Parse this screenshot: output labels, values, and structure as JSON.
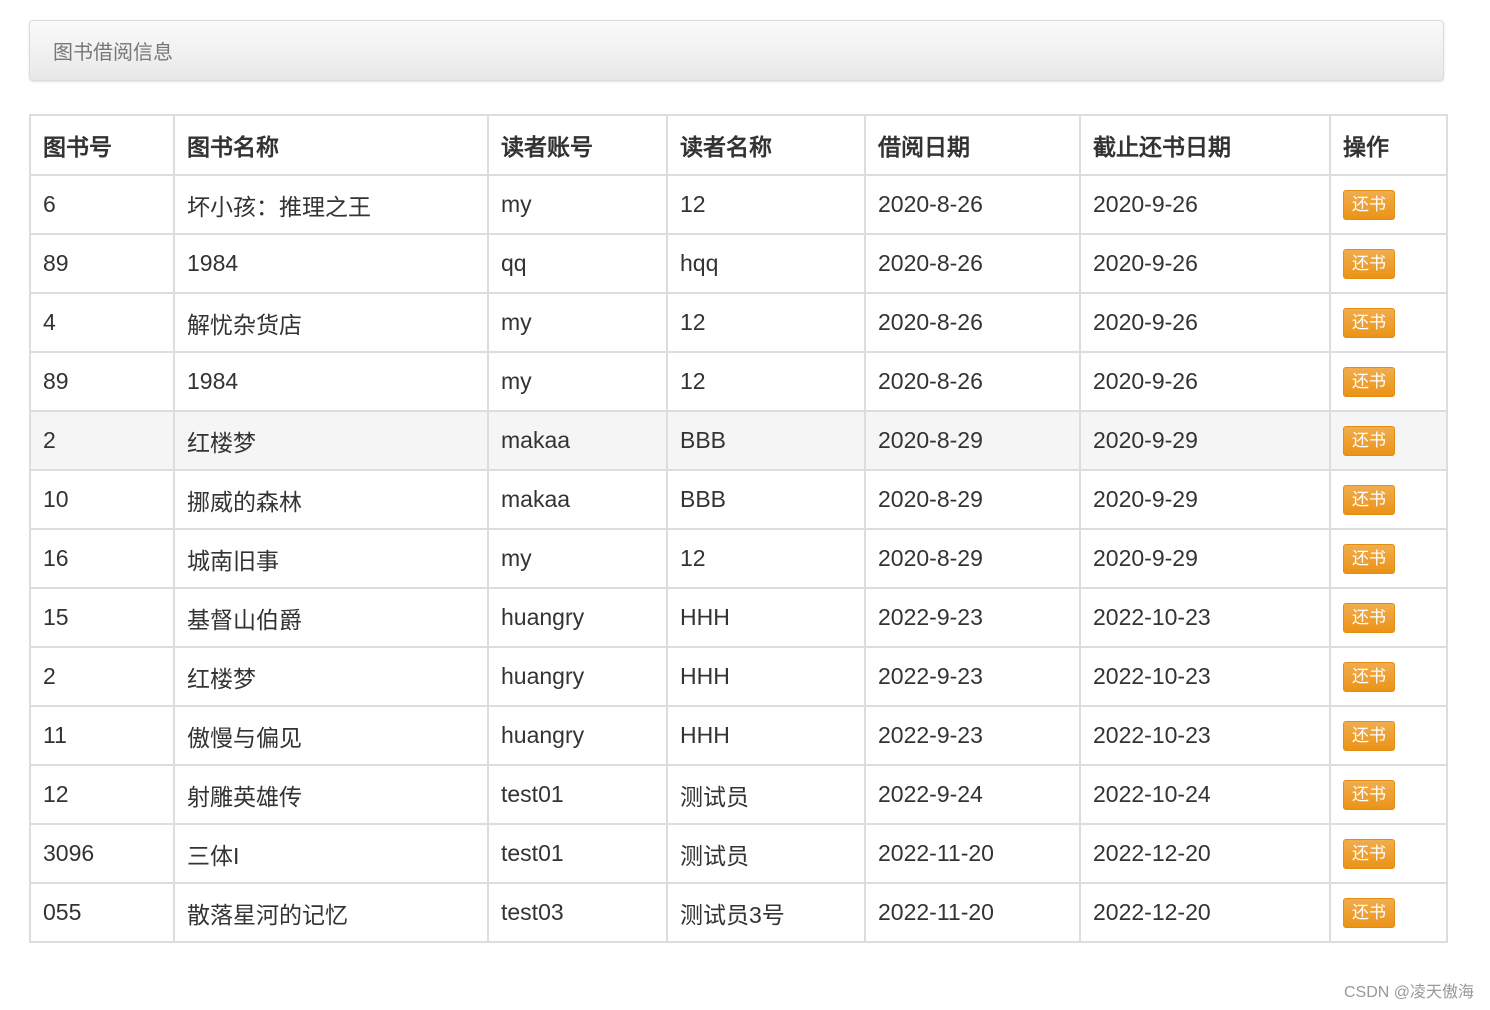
{
  "panel": {
    "title": "图书借阅信息"
  },
  "table": {
    "columns": [
      "图书号",
      "图书名称",
      "读者账号",
      "读者名称",
      "借阅日期",
      "截止还书日期",
      "操作"
    ],
    "action_label": "还书",
    "rows": [
      {
        "book_id": "6",
        "book_name": "坏小孩：推理之王",
        "reader_account": "my",
        "reader_name": "12",
        "borrow_date": "2020-8-26",
        "due_date": "2020-9-26"
      },
      {
        "book_id": "89",
        "book_name": "1984",
        "reader_account": "qq",
        "reader_name": "hqq",
        "borrow_date": "2020-8-26",
        "due_date": "2020-9-26"
      },
      {
        "book_id": "4",
        "book_name": "解忧杂货店",
        "reader_account": "my",
        "reader_name": "12",
        "borrow_date": "2020-8-26",
        "due_date": "2020-9-26"
      },
      {
        "book_id": "89",
        "book_name": "1984",
        "reader_account": "my",
        "reader_name": "12",
        "borrow_date": "2020-8-26",
        "due_date": "2020-9-26"
      },
      {
        "book_id": "2",
        "book_name": "红楼梦",
        "reader_account": "makaa",
        "reader_name": "BBB",
        "borrow_date": "2020-8-29",
        "due_date": "2020-9-29"
      },
      {
        "book_id": "10",
        "book_name": "挪威的森林",
        "reader_account": "makaa",
        "reader_name": "BBB",
        "borrow_date": "2020-8-29",
        "due_date": "2020-9-29"
      },
      {
        "book_id": "16",
        "book_name": "城南旧事",
        "reader_account": "my",
        "reader_name": "12",
        "borrow_date": "2020-8-29",
        "due_date": "2020-9-29"
      },
      {
        "book_id": "15",
        "book_name": "基督山伯爵",
        "reader_account": "huangry",
        "reader_name": "HHH",
        "borrow_date": "2022-9-23",
        "due_date": "2022-10-23"
      },
      {
        "book_id": "2",
        "book_name": "红楼梦",
        "reader_account": "huangry",
        "reader_name": "HHH",
        "borrow_date": "2022-9-23",
        "due_date": "2022-10-23"
      },
      {
        "book_id": "11",
        "book_name": "傲慢与偏见",
        "reader_account": "huangry",
        "reader_name": "HHH",
        "borrow_date": "2022-9-23",
        "due_date": "2022-10-23"
      },
      {
        "book_id": "12",
        "book_name": "射雕英雄传",
        "reader_account": "test01",
        "reader_name": "测试员",
        "borrow_date": "2022-9-24",
        "due_date": "2022-10-24"
      },
      {
        "book_id": "3096",
        "book_name": "三体I",
        "reader_account": "test01",
        "reader_name": "测试员",
        "borrow_date": "2022-11-20",
        "due_date": "2022-12-20"
      },
      {
        "book_id": "055",
        "book_name": "散落星河的记忆",
        "reader_account": "test03",
        "reader_name": "测试员3号",
        "borrow_date": "2022-11-20",
        "due_date": "2022-12-20"
      }
    ],
    "highlighted_row_index": 4
  },
  "watermark": "CSDN @凌天傲海",
  "colors": {
    "button_orange": "#f0ad4e",
    "row_hover": "#f5f5f5",
    "border": "#dddddd"
  }
}
